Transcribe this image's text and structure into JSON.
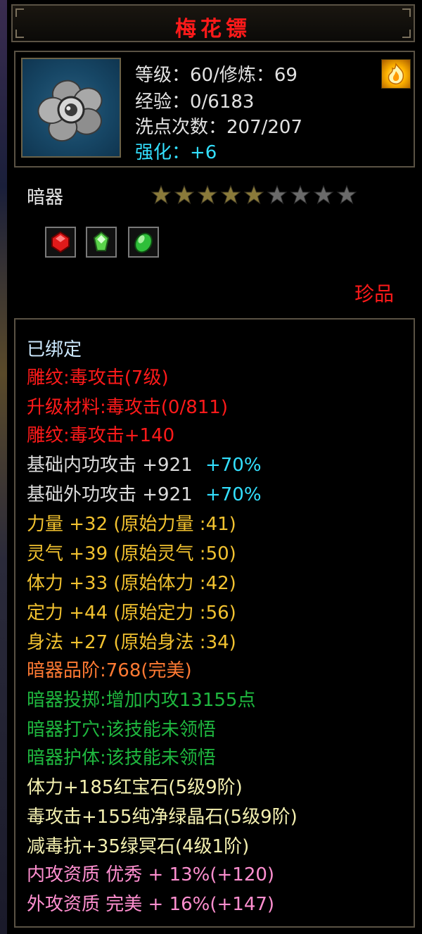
{
  "title": "梅花镖",
  "stats": {
    "level_line": "等级：60/修炼：69",
    "exp_line": "经验：0/6183",
    "wash_line": "洗点次数：207/207",
    "enhance_line": "强化：+6"
  },
  "item_icon": "plum-blossom-dart-icon",
  "badge_icon": "golden-flame-icon",
  "type_label": "暗器",
  "stars": {
    "filled": 5,
    "total": 9,
    "filled_color": "#8a7a3a",
    "empty_color": "#6a6a6a"
  },
  "gems": [
    {
      "icon": "red-gem-icon",
      "color": "#e01a1a"
    },
    {
      "icon": "green-crystal-icon",
      "color": "#5ad24a"
    },
    {
      "icon": "green-gem-icon",
      "color": "#2fbf3a"
    }
  ],
  "rarity": "珍品",
  "attributes": {
    "bound": "已绑定",
    "engrave1": "雕纹:毒攻击(7级)",
    "upgrade_material": "升级材料:毒攻击(0/811)",
    "engrave2": "雕纹:毒攻击+140",
    "base_inner": {
      "text": "基础内功攻击 +921",
      "pct": "+70%"
    },
    "base_outer": {
      "text": "基础外功攻击 +921",
      "pct": "+70%"
    },
    "strength": "力量 +32 (原始力量 :41)",
    "spirit": "灵气 +39 (原始灵气 :50)",
    "stamina": "体力 +33 (原始体力 :42)",
    "focus": "定力 +44 (原始定力 :56)",
    "agility": "身法 +27 (原始身法 :34)",
    "grade": "暗器品阶:768(完美)",
    "throw": "暗器投掷:增加内攻13155点",
    "acupoint": "暗器打穴:该技能未领悟",
    "guard": "暗器护体:该技能未领悟",
    "gem1": "体力+185红宝石(5级9阶)",
    "gem2": "毒攻击+155纯净绿晶石(5级9阶)",
    "gem3": "减毒抗+35绿冥石(4级1阶)",
    "inner_quality": "内攻资质 优秀 + 13%(+120)",
    "outer_quality": "外攻资质 完美 + 16%(+147)"
  }
}
